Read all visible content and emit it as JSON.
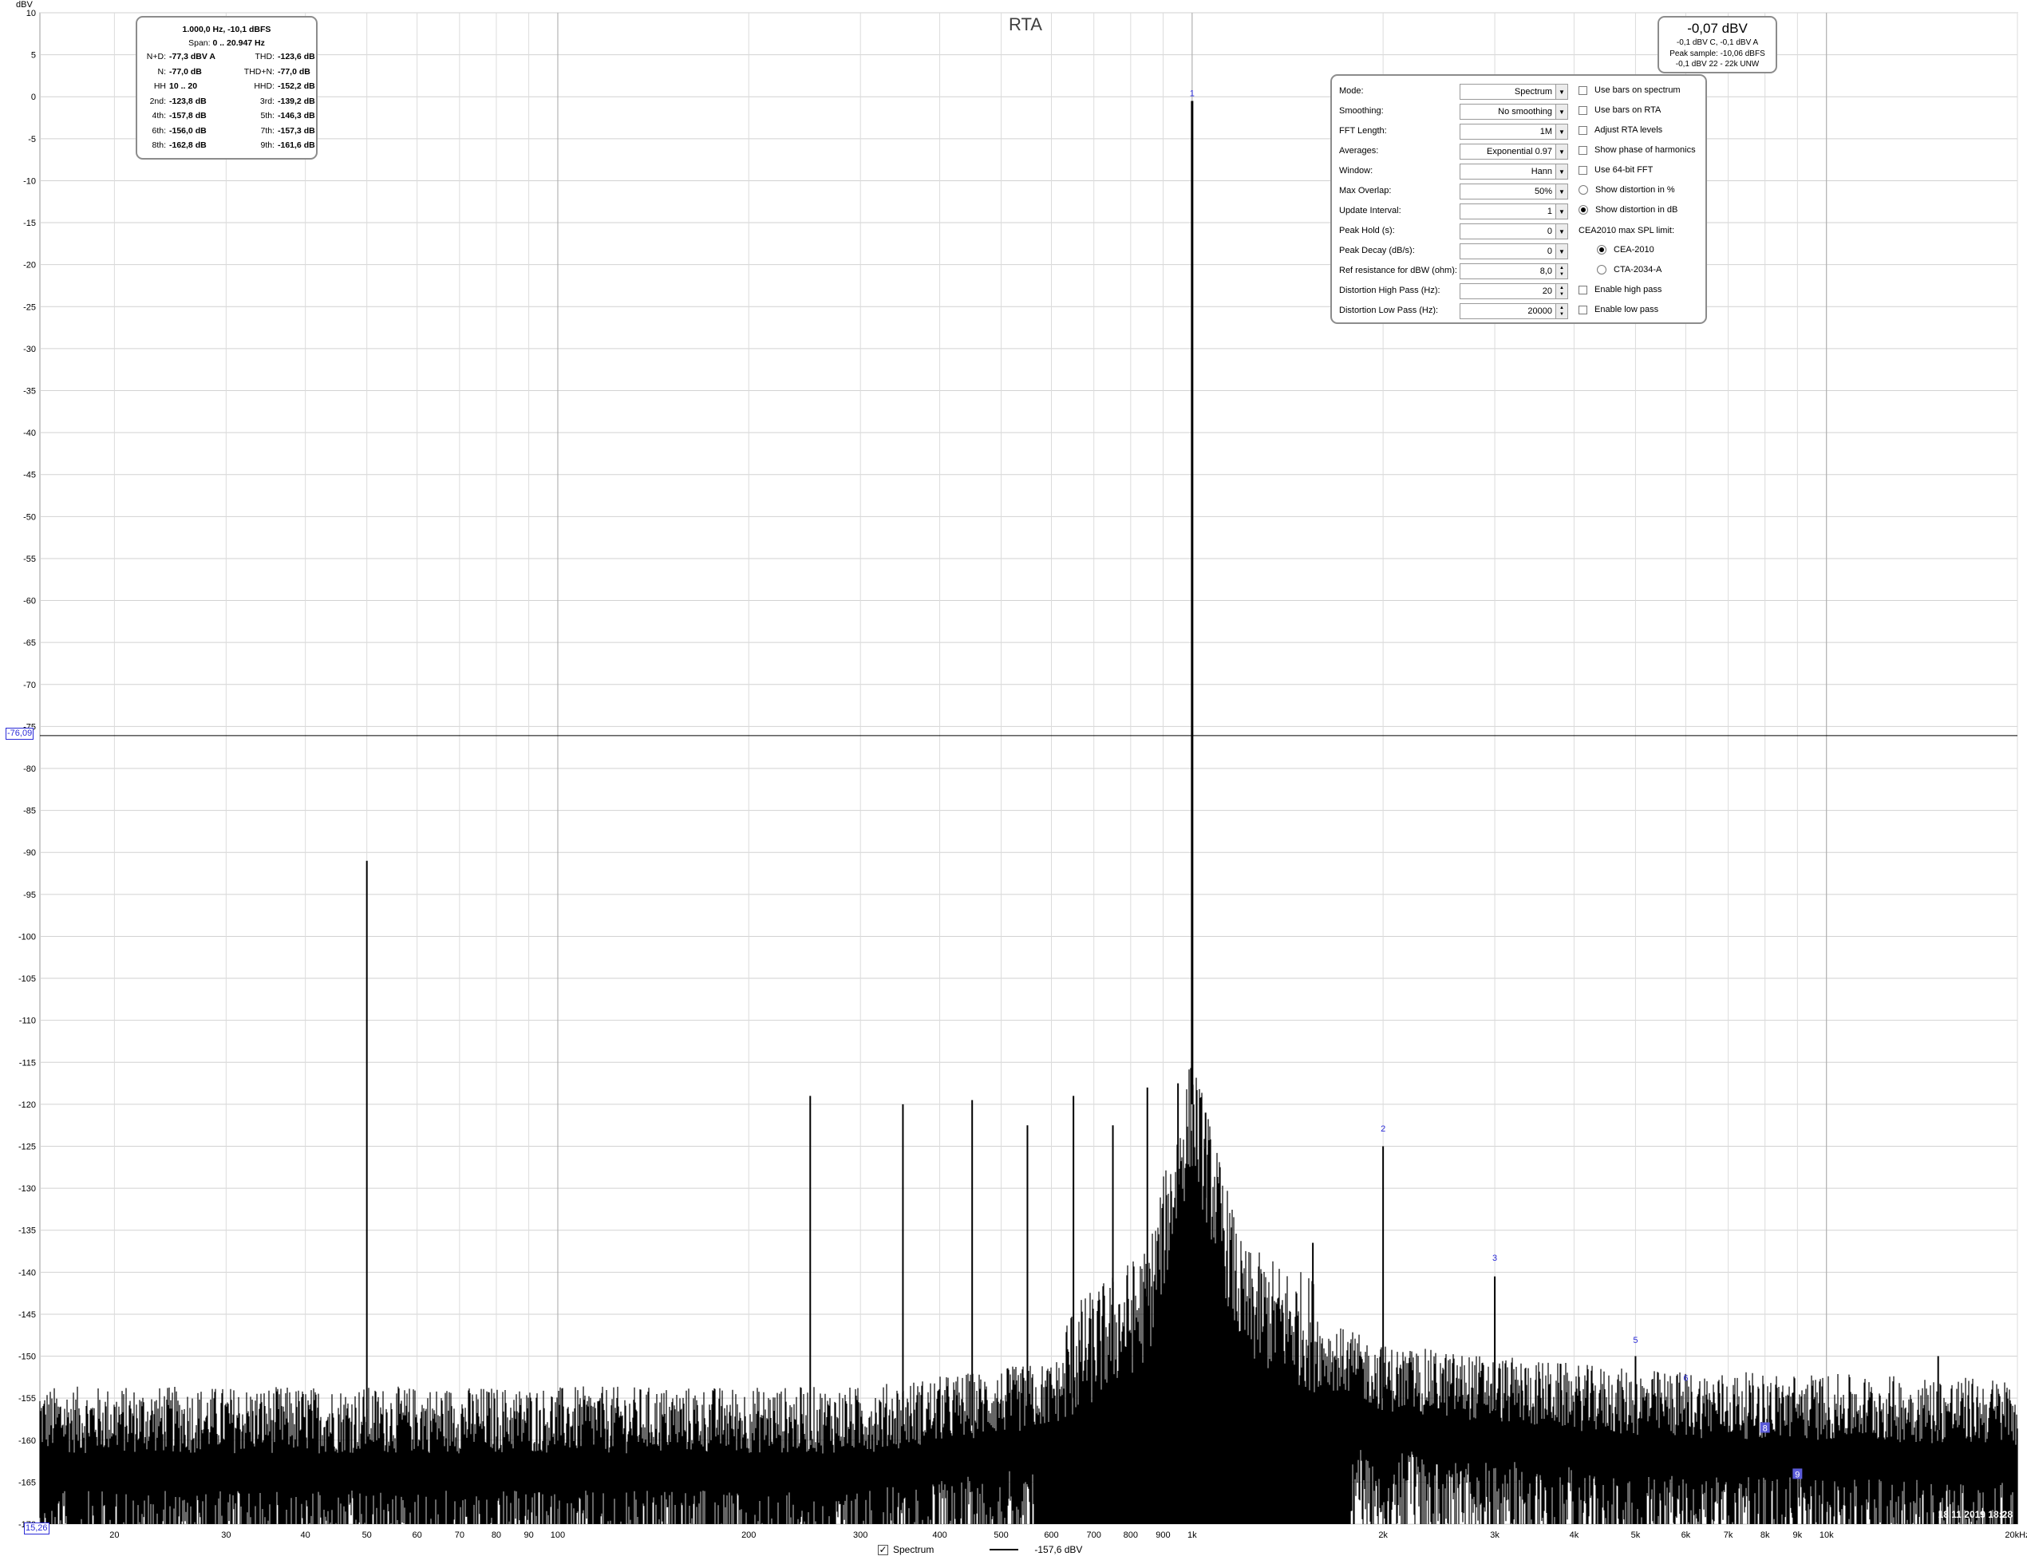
{
  "chart_data": {
    "type": "line",
    "title": "RTA",
    "ylabel": "dBV",
    "x_unit": "Hz",
    "xscale": "log",
    "xlim": [
      15.26,
      20000
    ],
    "ylim": [
      -170,
      10
    ],
    "grid": true,
    "y_ticks": [
      10,
      5,
      0,
      -5,
      -10,
      -15,
      -20,
      -25,
      -30,
      -35,
      -40,
      -45,
      -50,
      -55,
      -60,
      -65,
      -70,
      -75,
      -80,
      -85,
      -90,
      -95,
      -100,
      -105,
      -110,
      -115,
      -120,
      -125,
      -130,
      -135,
      -140,
      -145,
      -150,
      -155,
      -160,
      -165,
      -170
    ],
    "x_ticks": [
      {
        "v": 20,
        "label": "20"
      },
      {
        "v": 30,
        "label": "30"
      },
      {
        "v": 40,
        "label": "40"
      },
      {
        "v": 50,
        "label": "50"
      },
      {
        "v": 60,
        "label": "60"
      },
      {
        "v": 70,
        "label": "70"
      },
      {
        "v": 80,
        "label": "80"
      },
      {
        "v": 90,
        "label": "90"
      },
      {
        "v": 100,
        "label": "100"
      },
      {
        "v": 200,
        "label": "200"
      },
      {
        "v": 300,
        "label": "300"
      },
      {
        "v": 400,
        "label": "400"
      },
      {
        "v": 500,
        "label": "500"
      },
      {
        "v": 600,
        "label": "600"
      },
      {
        "v": 700,
        "label": "700"
      },
      {
        "v": 800,
        "label": "800"
      },
      {
        "v": 900,
        "label": "900"
      },
      {
        "v": 1000,
        "label": "1k"
      },
      {
        "v": 2000,
        "label": "2k"
      },
      {
        "v": 3000,
        "label": "3k"
      },
      {
        "v": 4000,
        "label": "4k"
      },
      {
        "v": 5000,
        "label": "5k"
      },
      {
        "v": 6000,
        "label": "6k"
      },
      {
        "v": 7000,
        "label": "7k"
      },
      {
        "v": 8000,
        "label": "8k"
      },
      {
        "v": 9000,
        "label": "9k"
      },
      {
        "v": 10000,
        "label": "10k"
      },
      {
        "v": 20000,
        "label": "20kHz"
      }
    ],
    "series": [
      {
        "name": "Spectrum",
        "color": "#000000",
        "fundamental": {
          "x": 1000,
          "y": -0.5
        },
        "spurs": [
          {
            "x": 50,
            "y": -91
          },
          {
            "x": 250,
            "y": -119
          },
          {
            "x": 350,
            "y": -120
          },
          {
            "x": 450,
            "y": -119.5
          },
          {
            "x": 550,
            "y": -122.5
          },
          {
            "x": 650,
            "y": -119
          },
          {
            "x": 750,
            "y": -122.5
          },
          {
            "x": 850,
            "y": -118
          },
          {
            "x": 950,
            "y": -117.5
          },
          {
            "x": 1050,
            "y": -121
          },
          {
            "x": 1550,
            "y": -136.5
          },
          {
            "x": 2000,
            "y": -125
          },
          {
            "x": 3000,
            "y": -140.5
          },
          {
            "x": 5000,
            "y": -150
          },
          {
            "x": 15000,
            "y": -150
          }
        ],
        "noise_floor": [
          {
            "x": 15.26,
            "y": -160
          },
          {
            "x": 100,
            "y": -160
          },
          {
            "x": 300,
            "y": -160
          },
          {
            "x": 600,
            "y": -157
          },
          {
            "x": 850,
            "y": -148
          },
          {
            "x": 1000,
            "y": -125
          },
          {
            "x": 1200,
            "y": -148
          },
          {
            "x": 2000,
            "y": -155
          },
          {
            "x": 5000,
            "y": -158
          },
          {
            "x": 20000,
            "y": -159
          }
        ]
      }
    ],
    "harmonic_markers": [
      {
        "label": "1",
        "x": 1000,
        "y": -0.5
      },
      {
        "label": "2",
        "x": 2000,
        "y": -123.8
      },
      {
        "label": "3",
        "x": 3000,
        "y": -139.2
      },
      {
        "label": "5",
        "x": 5000,
        "y": -149
      },
      {
        "label": "6",
        "x": 6000,
        "y": -153.5
      },
      {
        "label": "8",
        "x": 8000,
        "y": -159.5
      },
      {
        "label": "9",
        "x": 9000,
        "y": -165
      }
    ],
    "cursor": {
      "x_label": "15,26",
      "y_label": "-76,09",
      "y": -76.09
    }
  },
  "stats": {
    "header": "1.000,0 Hz, -10,1 dBFS",
    "span_prefix": "Span:",
    "span_value": "0 .. 20.947 Hz",
    "rows": [
      [
        {
          "k": "N+D:",
          "v": "-77,3 dBV A"
        },
        {
          "k": "THD:",
          "v": "-123,6 dB"
        }
      ],
      [
        {
          "k": "N:",
          "v": "-77,0 dB"
        },
        {
          "k": "THD+N:",
          "v": "-77,0 dB"
        }
      ],
      [
        {
          "k": "HH",
          "v": "10 .. 20"
        },
        {
          "k": "HHD:",
          "v": "-152,2 dB"
        }
      ],
      [
        {
          "k": "2nd:",
          "v": "-123,8 dB"
        },
        {
          "k": "3rd:",
          "v": "-139,2 dB"
        }
      ],
      [
        {
          "k": "4th:",
          "v": "-157,8 dB"
        },
        {
          "k": "5th:",
          "v": "-146,3 dB"
        }
      ],
      [
        {
          "k": "6th:",
          "v": "-156,0 dB"
        },
        {
          "k": "7th:",
          "v": "-157,3 dB"
        }
      ],
      [
        {
          "k": "8th:",
          "v": "-162,8 dB"
        },
        {
          "k": "9th:",
          "v": "-161,6 dB"
        }
      ]
    ]
  },
  "level": {
    "big": "-0,07 dBV",
    "line1": "-0,1 dBV C, -0,1 dBV A",
    "line2": "Peak sample: -10,06 dBFS",
    "line3": "-0,1 dBV 22 - 22k UNW"
  },
  "settings": {
    "rows": [
      {
        "label": "Mode:",
        "value": "Spectrum",
        "kind": "combo"
      },
      {
        "label": "Smoothing:",
        "value": "No  smoothing",
        "kind": "combo"
      },
      {
        "label": "FFT Length:",
        "value": "1M",
        "kind": "combo"
      },
      {
        "label": "Averages:",
        "value": "Exponential 0.97",
        "kind": "combo"
      },
      {
        "label": "Window:",
        "value": "Hann",
        "kind": "combo"
      },
      {
        "label": "Max Overlap:",
        "value": "50%",
        "kind": "combo"
      },
      {
        "label": "Update Interval:",
        "value": "1",
        "kind": "combo"
      },
      {
        "label": "Peak Hold (s):",
        "value": "0",
        "kind": "combo"
      },
      {
        "label": "Peak Decay (dB/s):",
        "value": "0",
        "kind": "combo"
      },
      {
        "label": "Ref resistance for dBW (ohm):",
        "value": "8,0",
        "kind": "spin"
      },
      {
        "label": "Distortion High Pass (Hz):",
        "value": "20",
        "kind": "spin"
      },
      {
        "label": "Distortion Low Pass (Hz):",
        "value": "20000",
        "kind": "spin"
      }
    ],
    "options": [
      {
        "label": "Use bars on spectrum",
        "kind": "check",
        "on": false
      },
      {
        "label": "Use bars on RTA",
        "kind": "check",
        "on": false
      },
      {
        "label": "Adjust RTA levels",
        "kind": "check",
        "on": false
      },
      {
        "label": "Show phase of harmonics",
        "kind": "check",
        "on": false
      },
      {
        "label": "Use 64-bit FFT",
        "kind": "check",
        "on": false
      },
      {
        "label": "Show distortion in %",
        "kind": "radio",
        "on": false
      },
      {
        "label": "Show distortion in dB",
        "kind": "radio",
        "on": true
      },
      {
        "label": "CEA2010 max SPL limit:",
        "kind": "text",
        "on": false
      },
      {
        "label": "CEA-2010",
        "kind": "radio-sub",
        "on": true
      },
      {
        "label": "CTA-2034-A",
        "kind": "radio-sub",
        "on": false
      },
      {
        "label": "Enable high pass",
        "kind": "check",
        "on": false
      },
      {
        "label": "Enable low pass",
        "kind": "check",
        "on": false
      }
    ]
  },
  "legend": {
    "spectrum_label": "Spectrum",
    "spectrum_checked": true,
    "value": "-157,6 dBV"
  },
  "datestamp": "18.11.2019 18:28"
}
